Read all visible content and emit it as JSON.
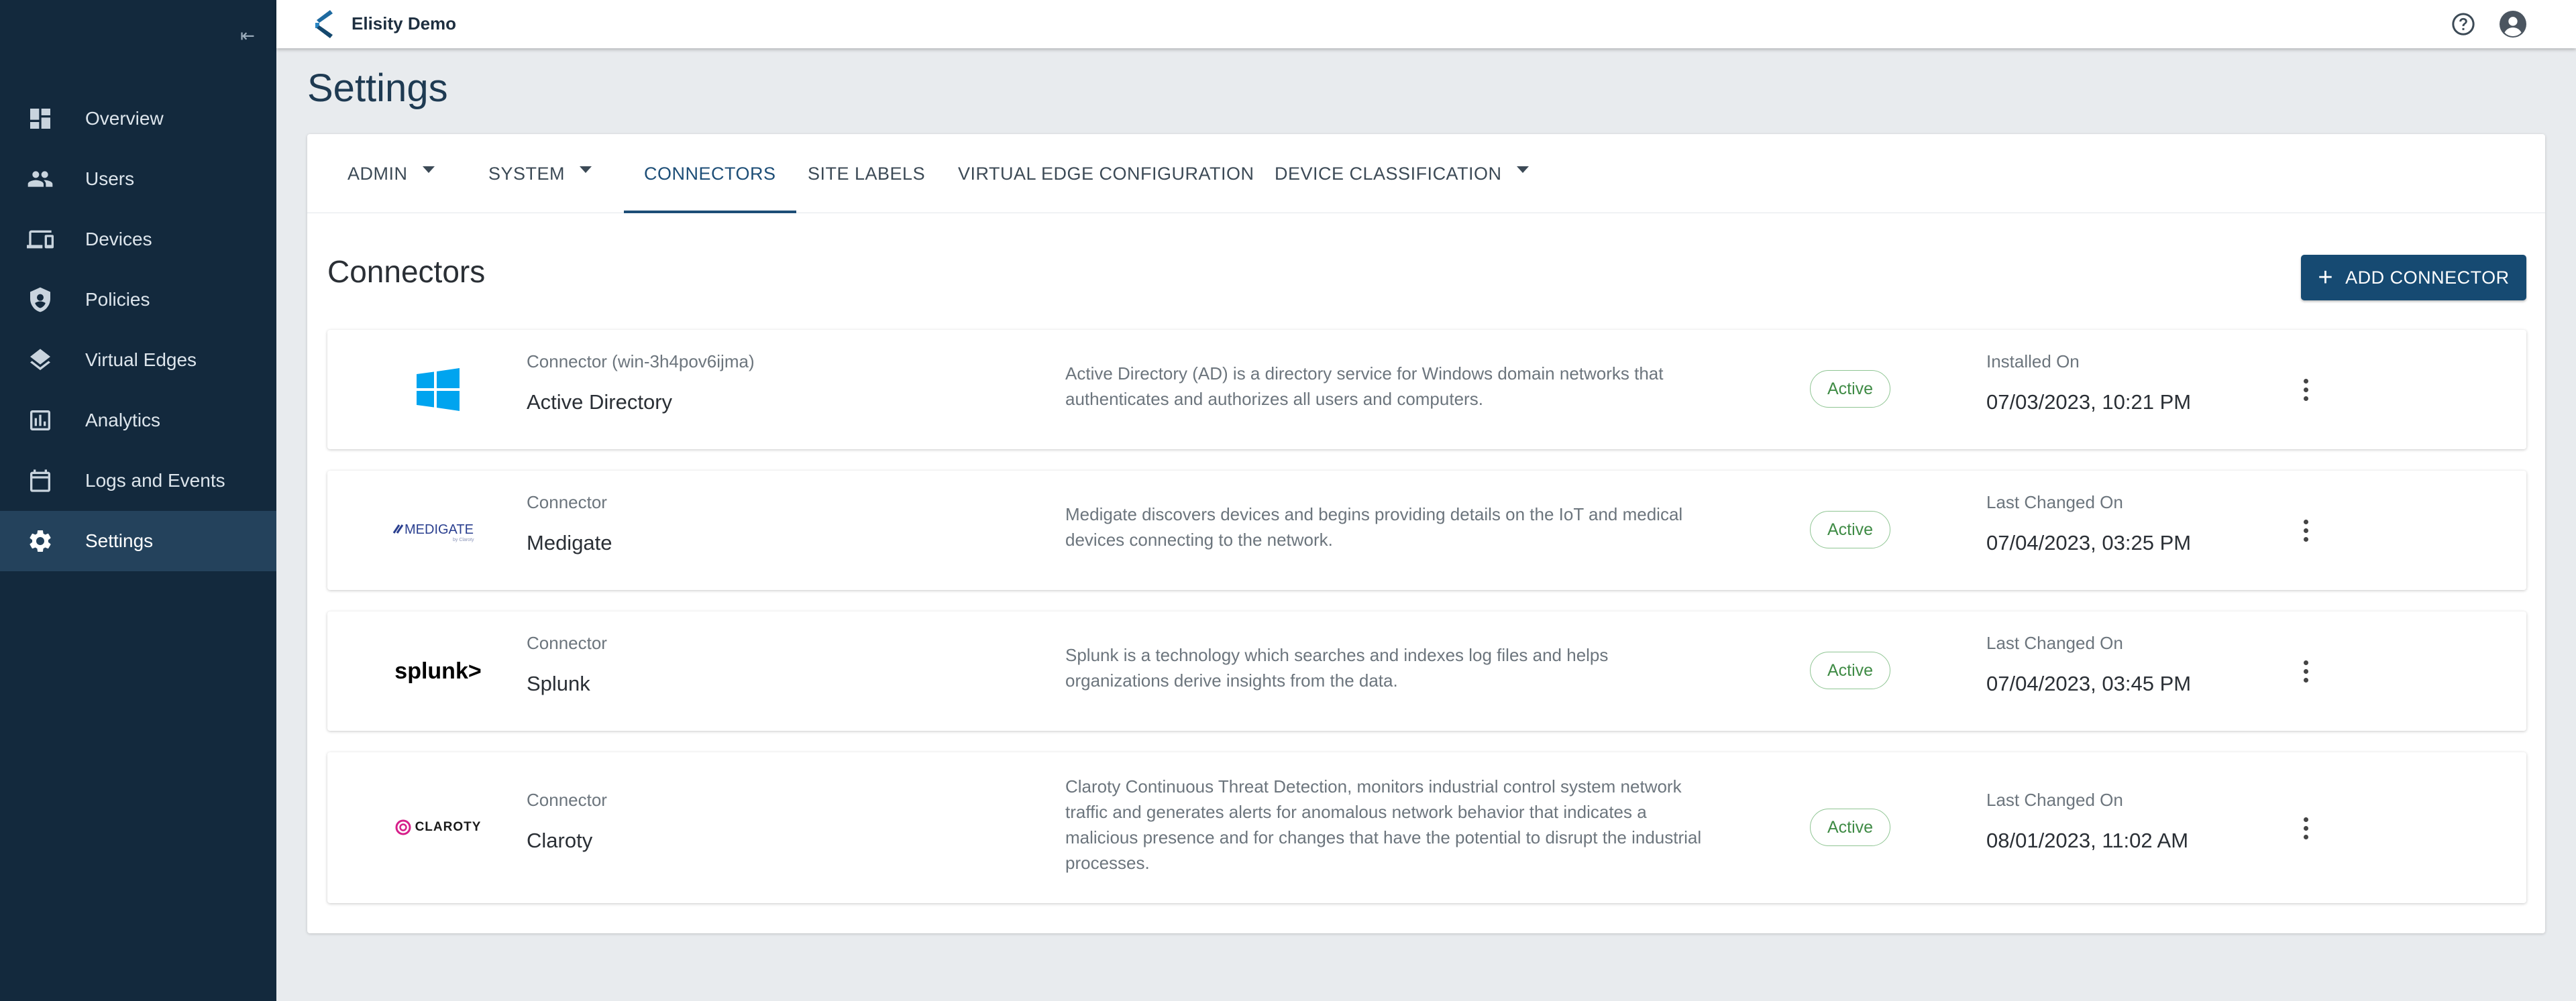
{
  "app": {
    "name": "Elisity Demo"
  },
  "sidebar": {
    "items": [
      {
        "label": "Overview",
        "icon": "dashboard-icon"
      },
      {
        "label": "Users",
        "icon": "users-icon"
      },
      {
        "label": "Devices",
        "icon": "devices-icon"
      },
      {
        "label": "Policies",
        "icon": "shield-icon"
      },
      {
        "label": "Virtual Edges",
        "icon": "layers-icon"
      },
      {
        "label": "Analytics",
        "icon": "bar-chart-icon"
      },
      {
        "label": "Logs and Events",
        "icon": "calendar-icon"
      },
      {
        "label": "Settings",
        "icon": "gear-icon",
        "active": true
      }
    ]
  },
  "page": {
    "title": "Settings"
  },
  "tabs": [
    {
      "label": "ADMIN",
      "dropdown": true
    },
    {
      "label": "SYSTEM",
      "dropdown": true
    },
    {
      "label": "CONNECTORS",
      "active": true
    },
    {
      "label": "SITE LABELS"
    },
    {
      "label": "VIRTUAL EDGE CONFIGURATION"
    },
    {
      "label": "DEVICE CLASSIFICATION",
      "dropdown": true
    }
  ],
  "section": {
    "title": "Connectors",
    "add_button": "ADD CONNECTOR"
  },
  "connectors": [
    {
      "logo": "windows-logo",
      "type_label": "Connector (win-3h4pov6ijma)",
      "name": "Active Directory",
      "description": "Active Directory (AD) is a directory service for Windows domain networks that authenticates and authorizes all users and computers.",
      "status": "Active",
      "timestamp_label": "Installed On",
      "timestamp": "07/03/2023, 10:21 PM"
    },
    {
      "logo": "medigate-logo",
      "logo_text": "MEDIGATE",
      "type_label": "Connector",
      "name": "Medigate",
      "description": "Medigate discovers devices and begins providing details on the IoT and medical devices connecting to the network.",
      "status": "Active",
      "timestamp_label": "Last Changed On",
      "timestamp": "07/04/2023, 03:25 PM"
    },
    {
      "logo": "splunk-logo",
      "logo_text": "splunk>",
      "type_label": "Connector",
      "name": "Splunk",
      "description": "Splunk is a technology which searches and indexes log files and helps organizations derive insights from the data.",
      "status": "Active",
      "timestamp_label": "Last Changed On",
      "timestamp": "07/04/2023, 03:45 PM"
    },
    {
      "logo": "claroty-logo",
      "logo_text": "CLAROTY",
      "type_label": "Connector",
      "name": "Claroty",
      "description": "Claroty Continuous Threat Detection, monitors industrial control system network traffic and generates alerts for anomalous network behavior that indicates a malicious presence and for changes that have the potential to disrupt the industrial processes.",
      "status": "Active",
      "timestamp_label": "Last Changed On",
      "timestamp": "08/01/2023, 11:02 AM"
    }
  ],
  "colors": {
    "sidebar": "#13293d",
    "accent": "#164a72",
    "active_badge": "#3f8b45"
  }
}
